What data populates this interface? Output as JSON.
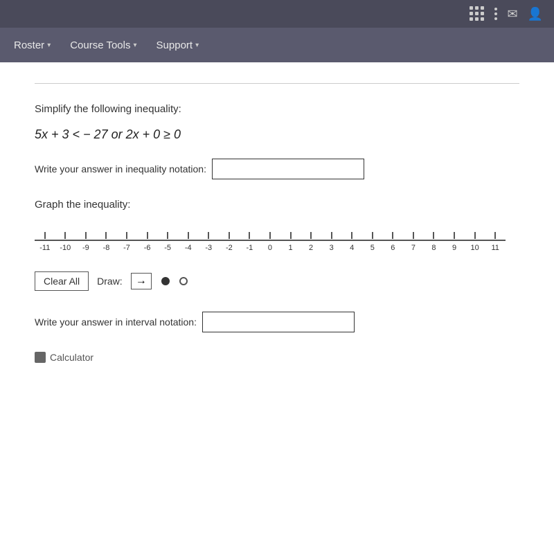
{
  "topbar": {
    "bg": "#4a4a5a"
  },
  "navbar": {
    "items": [
      {
        "label": "Roster",
        "id": "roster"
      },
      {
        "label": "Course Tools",
        "id": "course-tools"
      },
      {
        "label": "Support",
        "id": "support"
      }
    ]
  },
  "main": {
    "instruction": "Simplify the following inequality:",
    "expression": "5x + 3 < − 27 or 2x + 0 ≥ 0",
    "inequality_label": "Write your answer in inequality notation:",
    "inequality_placeholder": "",
    "graph_label": "Graph the inequality:",
    "number_line": {
      "ticks": [
        "-11",
        "-10",
        "-9",
        "-8",
        "-7",
        "-6",
        "-5",
        "-4",
        "-3",
        "-2",
        "-1",
        "0",
        "1",
        "2",
        "3",
        "4",
        "5",
        "6",
        "7",
        "8",
        "9",
        "10",
        "11"
      ]
    },
    "clear_all": "Clear All",
    "draw_label": "Draw:",
    "interval_label": "Write your answer in interval notation:",
    "interval_placeholder": "",
    "calculator_label": "Calculator"
  }
}
